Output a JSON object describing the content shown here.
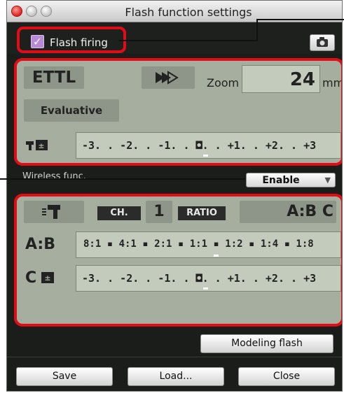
{
  "window": {
    "title": "Flash function settings"
  },
  "flash_firing": {
    "label": "Flash firing",
    "checked": true
  },
  "panel1": {
    "mode": "ETTL",
    "zoom_label": "Zoom",
    "zoom_value": "24",
    "zoom_unit": "mm",
    "metering": "Evaluative",
    "fec_scale": "-3. . -2. . -1. . ◘. . +1. . +2. . +3"
  },
  "wireless": {
    "label": "Wireless func.",
    "value": "Enable"
  },
  "panel2": {
    "channel_label": "CH.",
    "channel_value": "1",
    "ratio_label": "RATIO",
    "group_setting": "A:B C",
    "ab_label": "A:B",
    "ratio_scale": "8:1 ▪ 4:1 ▪ 2:1 ▪ 1:1 ▪ 1:2 ▪ 1:4 ▪ 1:8",
    "c_label": "C",
    "c_scale": "-3. . -2. . -1. . ◘. . +1. . +2. . +3"
  },
  "buttons": {
    "modeling_flash": "Modeling flash",
    "save": "Save",
    "load": "Load...",
    "close": "Close"
  },
  "colors": {
    "highlight_red": "#e00d17",
    "lcd_panel": "#a5ae9f",
    "background": "#1b1d1b"
  }
}
